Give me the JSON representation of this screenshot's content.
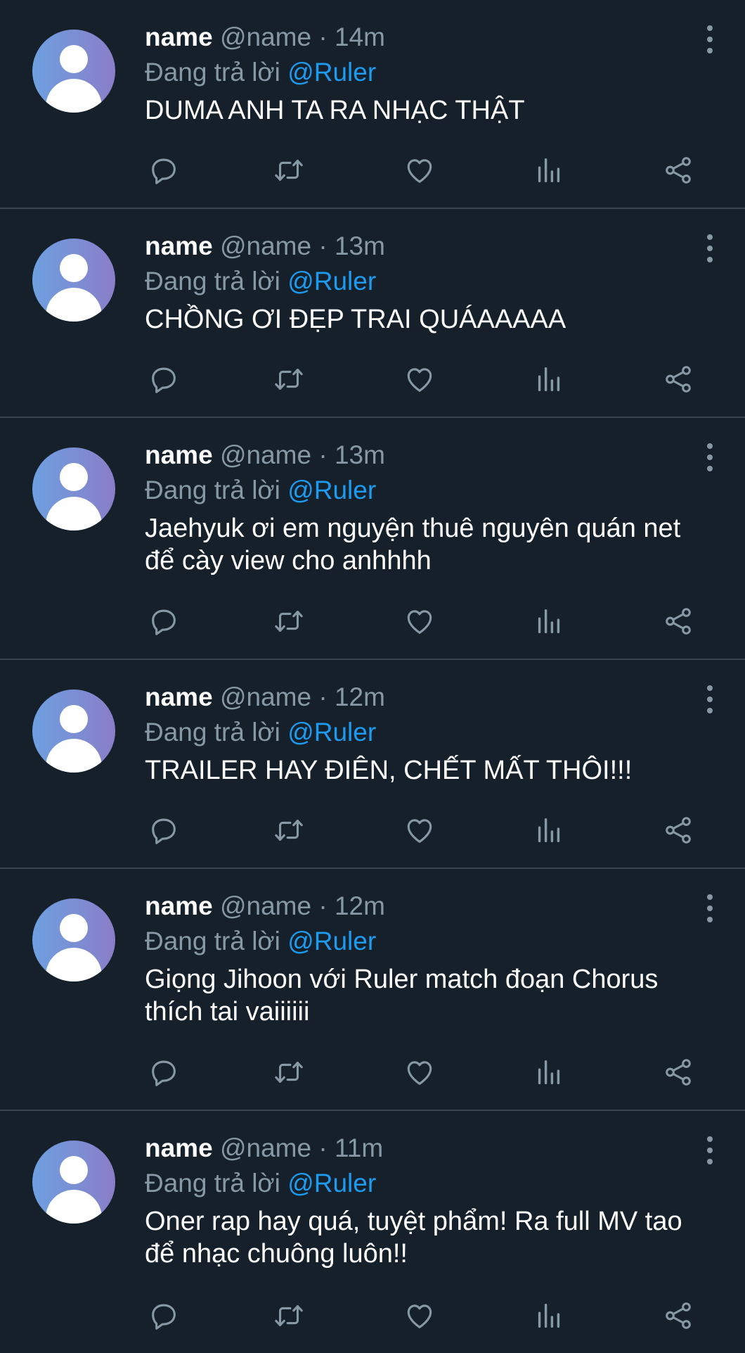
{
  "colors": {
    "background": "#15202b",
    "divider": "#38444d",
    "secondary_text": "#8899a6",
    "mention": "#1d9bf0",
    "primary_text": "#ffffff"
  },
  "icons": {
    "reply": "speech-bubble-icon",
    "retweet": "retweet-icon",
    "like": "heart-icon",
    "views": "bar-chart-icon",
    "share": "share-nodes-icon",
    "more": "vertical-ellipsis-icon",
    "avatar": "default-avatar-icon"
  },
  "tweets": [
    {
      "name": "name",
      "handle": "@name",
      "dot": "·",
      "time": "14m",
      "reply_prefix": "Đang trả lời",
      "reply_to": "@Ruler",
      "text": "DUMA ANH TA RA NHẠC THẬT"
    },
    {
      "name": "name",
      "handle": "@name",
      "dot": "·",
      "time": "13m",
      "reply_prefix": "Đang trả lời",
      "reply_to": "@Ruler",
      "text": "CHỒNG ƠI ĐẸP TRAI QUÁAAAAA"
    },
    {
      "name": "name",
      "handle": "@name",
      "dot": "·",
      "time": "13m",
      "reply_prefix": "Đang trả lời",
      "reply_to": "@Ruler",
      "text": "Jaehyuk ơi em nguyện thuê nguyên quán net để cày view cho anhhhh"
    },
    {
      "name": "name",
      "handle": "@name",
      "dot": "·",
      "time": "12m",
      "reply_prefix": "Đang trả lời",
      "reply_to": "@Ruler",
      "text": "TRAILER HAY ĐIÊN, CHẾT MẤT THÔI!!!"
    },
    {
      "name": "name",
      "handle": "@name",
      "dot": "·",
      "time": "12m",
      "reply_prefix": "Đang trả lời",
      "reply_to": "@Ruler",
      "text": "Giọng Jihoon với Ruler match đoạn Chorus thích tai vaiiiiii"
    },
    {
      "name": "name",
      "handle": "@name",
      "dot": "·",
      "time": "11m",
      "reply_prefix": "Đang trả lời",
      "reply_to": "@Ruler",
      "text": "Oner rap hay quá, tuyệt phẩm! Ra full MV tao để nhạc chuông luôn!!"
    }
  ]
}
